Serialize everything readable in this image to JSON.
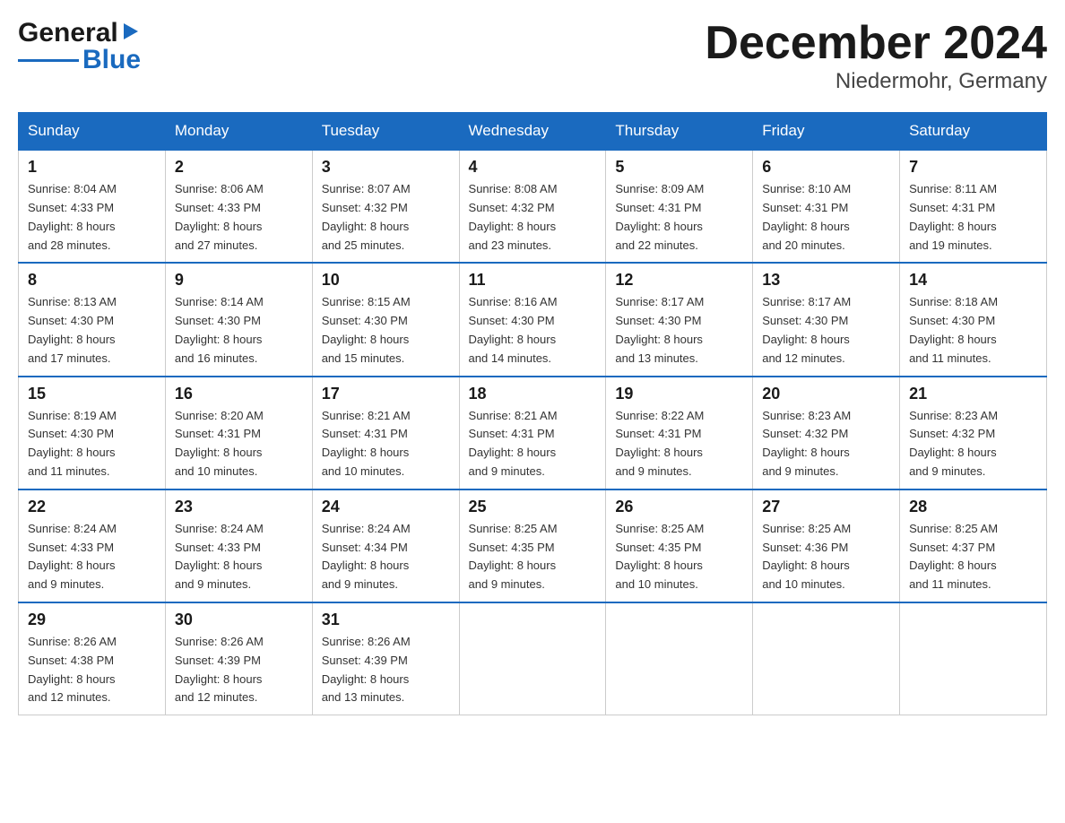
{
  "header": {
    "logo": {
      "general": "General",
      "triangle": "▶",
      "blue": "Blue"
    },
    "title": "December 2024",
    "subtitle": "Niedermohr, Germany"
  },
  "days_of_week": [
    "Sunday",
    "Monday",
    "Tuesday",
    "Wednesday",
    "Thursday",
    "Friday",
    "Saturday"
  ],
  "weeks": [
    [
      {
        "day": "1",
        "sunrise": "8:04 AM",
        "sunset": "4:33 PM",
        "daylight": "8 hours and 28 minutes."
      },
      {
        "day": "2",
        "sunrise": "8:06 AM",
        "sunset": "4:33 PM",
        "daylight": "8 hours and 27 minutes."
      },
      {
        "day": "3",
        "sunrise": "8:07 AM",
        "sunset": "4:32 PM",
        "daylight": "8 hours and 25 minutes."
      },
      {
        "day": "4",
        "sunrise": "8:08 AM",
        "sunset": "4:32 PM",
        "daylight": "8 hours and 23 minutes."
      },
      {
        "day": "5",
        "sunrise": "8:09 AM",
        "sunset": "4:31 PM",
        "daylight": "8 hours and 22 minutes."
      },
      {
        "day": "6",
        "sunrise": "8:10 AM",
        "sunset": "4:31 PM",
        "daylight": "8 hours and 20 minutes."
      },
      {
        "day": "7",
        "sunrise": "8:11 AM",
        "sunset": "4:31 PM",
        "daylight": "8 hours and 19 minutes."
      }
    ],
    [
      {
        "day": "8",
        "sunrise": "8:13 AM",
        "sunset": "4:30 PM",
        "daylight": "8 hours and 17 minutes."
      },
      {
        "day": "9",
        "sunrise": "8:14 AM",
        "sunset": "4:30 PM",
        "daylight": "8 hours and 16 minutes."
      },
      {
        "day": "10",
        "sunrise": "8:15 AM",
        "sunset": "4:30 PM",
        "daylight": "8 hours and 15 minutes."
      },
      {
        "day": "11",
        "sunrise": "8:16 AM",
        "sunset": "4:30 PM",
        "daylight": "8 hours and 14 minutes."
      },
      {
        "day": "12",
        "sunrise": "8:17 AM",
        "sunset": "4:30 PM",
        "daylight": "8 hours and 13 minutes."
      },
      {
        "day": "13",
        "sunrise": "8:17 AM",
        "sunset": "4:30 PM",
        "daylight": "8 hours and 12 minutes."
      },
      {
        "day": "14",
        "sunrise": "8:18 AM",
        "sunset": "4:30 PM",
        "daylight": "8 hours and 11 minutes."
      }
    ],
    [
      {
        "day": "15",
        "sunrise": "8:19 AM",
        "sunset": "4:30 PM",
        "daylight": "8 hours and 11 minutes."
      },
      {
        "day": "16",
        "sunrise": "8:20 AM",
        "sunset": "4:31 PM",
        "daylight": "8 hours and 10 minutes."
      },
      {
        "day": "17",
        "sunrise": "8:21 AM",
        "sunset": "4:31 PM",
        "daylight": "8 hours and 10 minutes."
      },
      {
        "day": "18",
        "sunrise": "8:21 AM",
        "sunset": "4:31 PM",
        "daylight": "8 hours and 9 minutes."
      },
      {
        "day": "19",
        "sunrise": "8:22 AM",
        "sunset": "4:31 PM",
        "daylight": "8 hours and 9 minutes."
      },
      {
        "day": "20",
        "sunrise": "8:23 AM",
        "sunset": "4:32 PM",
        "daylight": "8 hours and 9 minutes."
      },
      {
        "day": "21",
        "sunrise": "8:23 AM",
        "sunset": "4:32 PM",
        "daylight": "8 hours and 9 minutes."
      }
    ],
    [
      {
        "day": "22",
        "sunrise": "8:24 AM",
        "sunset": "4:33 PM",
        "daylight": "8 hours and 9 minutes."
      },
      {
        "day": "23",
        "sunrise": "8:24 AM",
        "sunset": "4:33 PM",
        "daylight": "8 hours and 9 minutes."
      },
      {
        "day": "24",
        "sunrise": "8:24 AM",
        "sunset": "4:34 PM",
        "daylight": "8 hours and 9 minutes."
      },
      {
        "day": "25",
        "sunrise": "8:25 AM",
        "sunset": "4:35 PM",
        "daylight": "8 hours and 9 minutes."
      },
      {
        "day": "26",
        "sunrise": "8:25 AM",
        "sunset": "4:35 PM",
        "daylight": "8 hours and 10 minutes."
      },
      {
        "day": "27",
        "sunrise": "8:25 AM",
        "sunset": "4:36 PM",
        "daylight": "8 hours and 10 minutes."
      },
      {
        "day": "28",
        "sunrise": "8:25 AM",
        "sunset": "4:37 PM",
        "daylight": "8 hours and 11 minutes."
      }
    ],
    [
      {
        "day": "29",
        "sunrise": "8:26 AM",
        "sunset": "4:38 PM",
        "daylight": "8 hours and 12 minutes."
      },
      {
        "day": "30",
        "sunrise": "8:26 AM",
        "sunset": "4:39 PM",
        "daylight": "8 hours and 12 minutes."
      },
      {
        "day": "31",
        "sunrise": "8:26 AM",
        "sunset": "4:39 PM",
        "daylight": "8 hours and 13 minutes."
      },
      null,
      null,
      null,
      null
    ]
  ],
  "labels": {
    "sunrise": "Sunrise:",
    "sunset": "Sunset:",
    "daylight": "Daylight:"
  }
}
